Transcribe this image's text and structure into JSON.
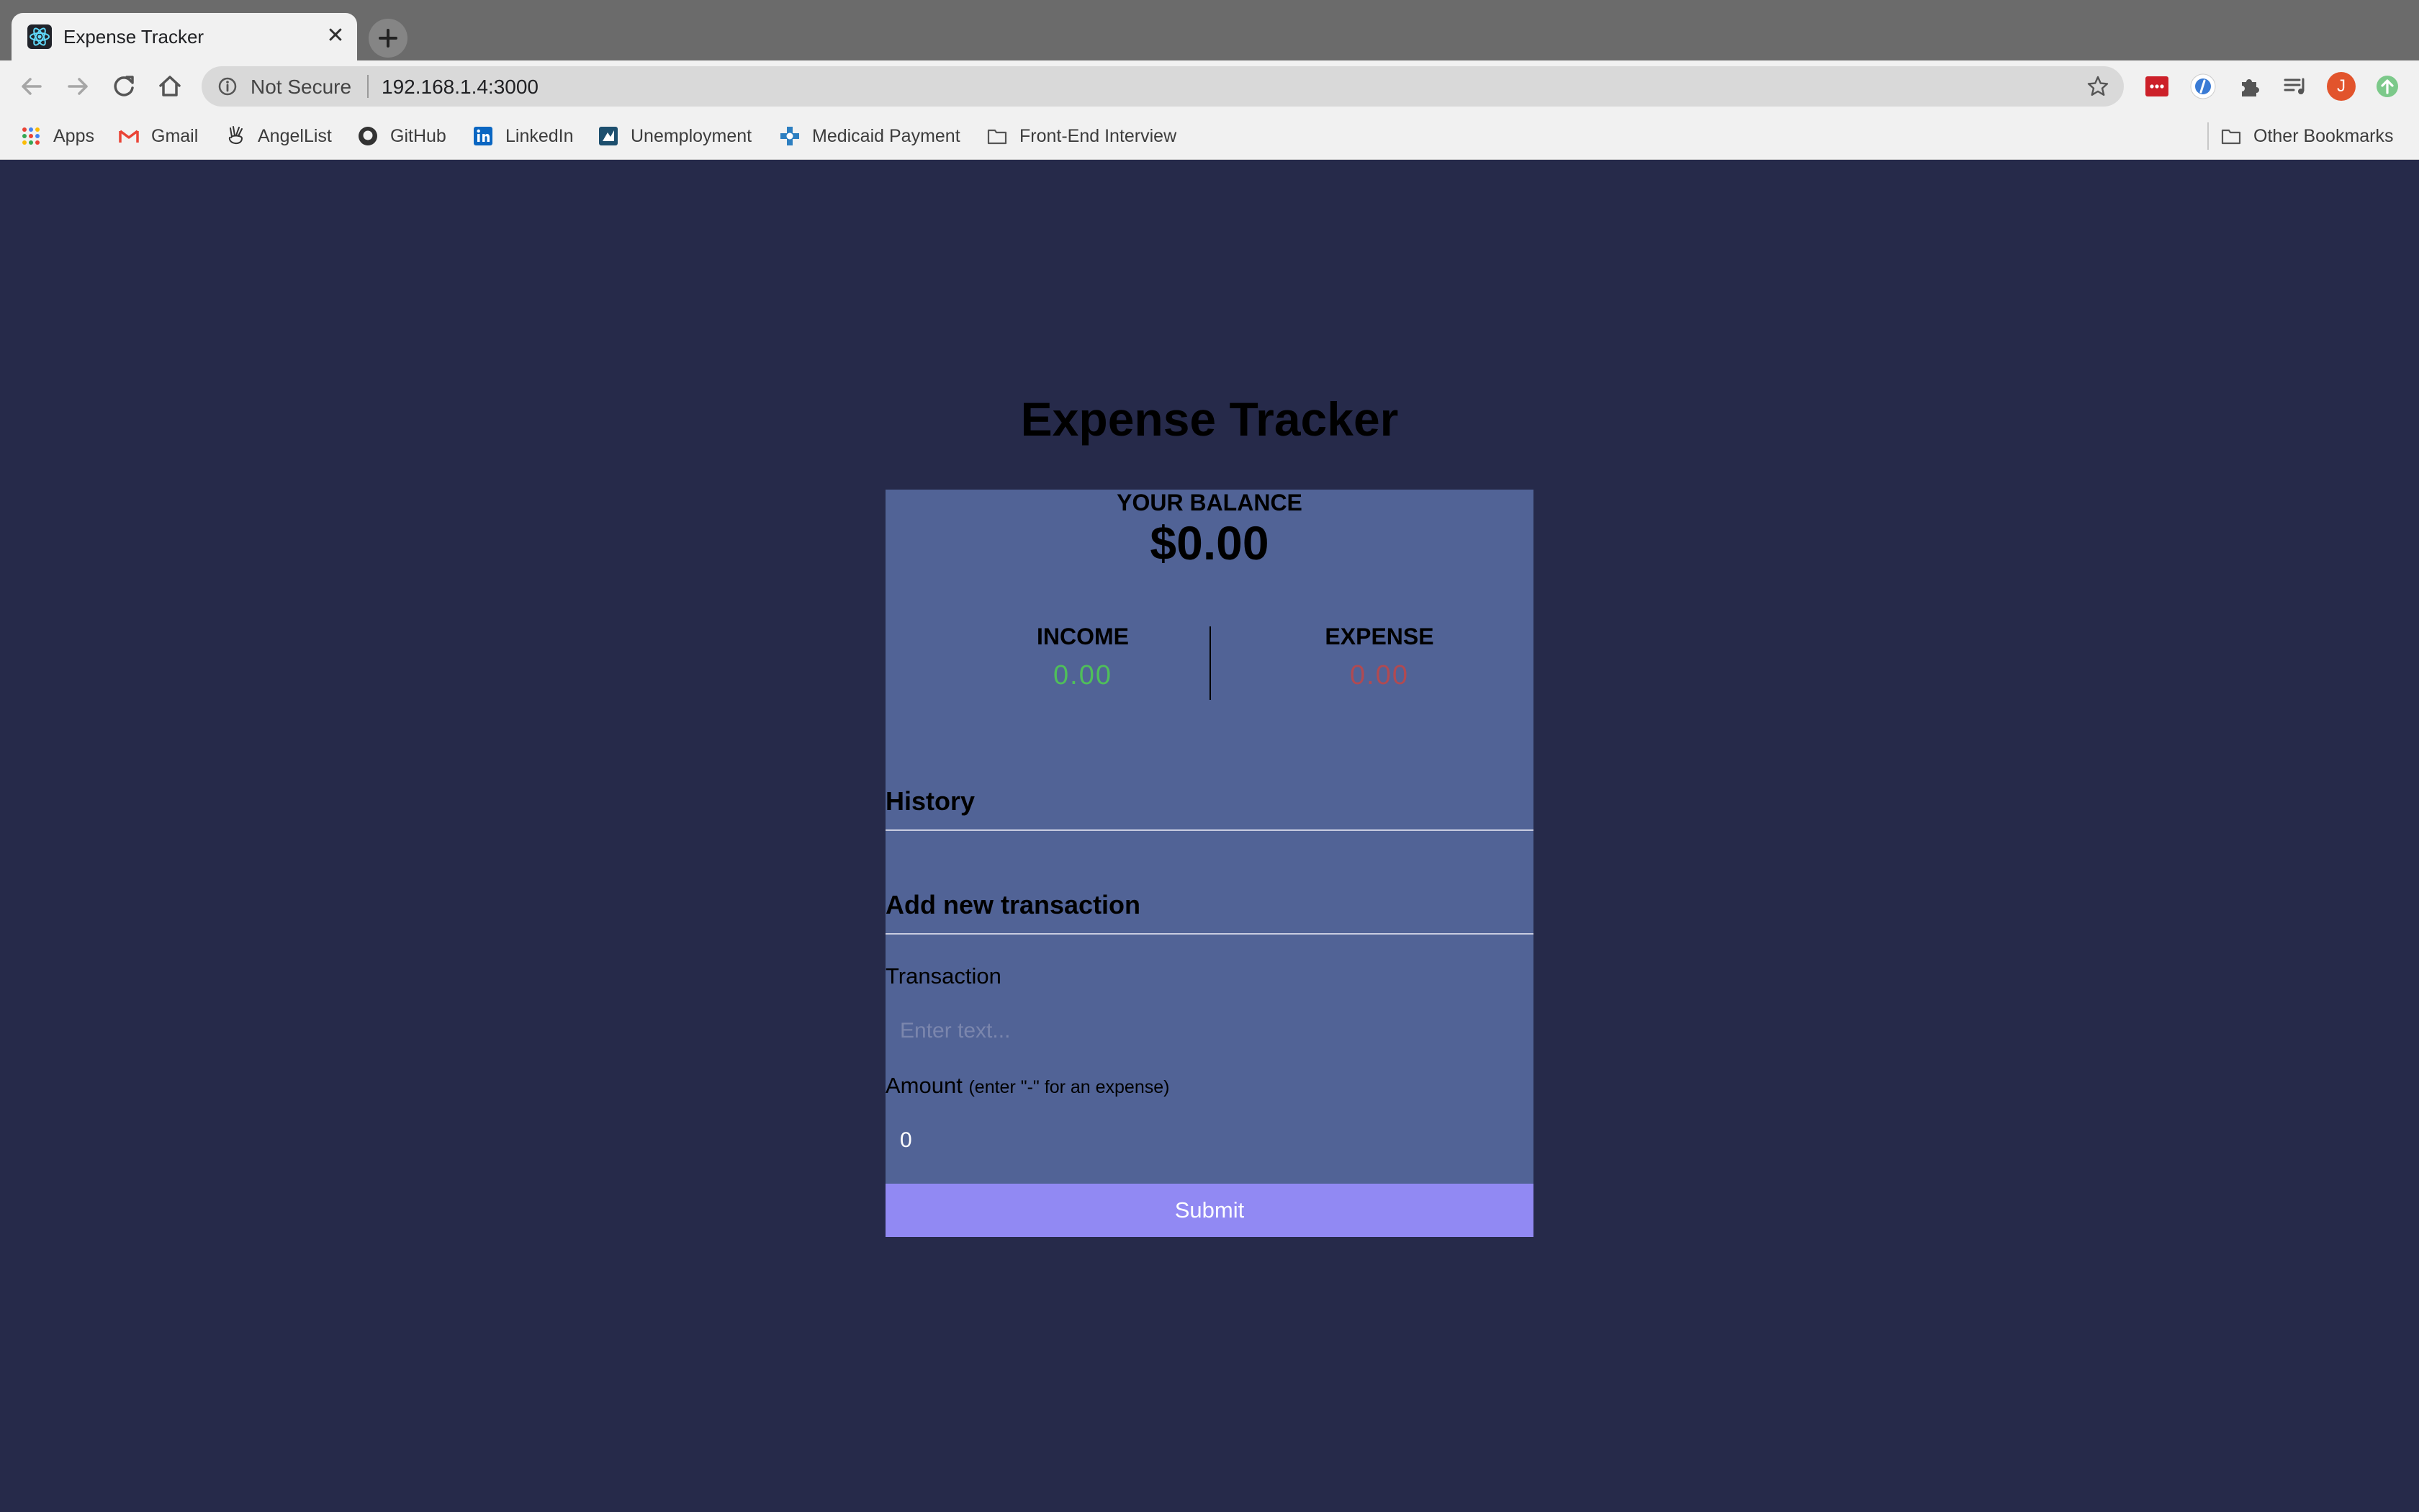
{
  "browser": {
    "tab_title": "Expense Tracker",
    "tab_close": "✕",
    "new_tab": "+",
    "not_secure": "Not Secure",
    "url": "192.168.1.4:3000",
    "bookmarks": [
      "Apps",
      "Gmail",
      "AngelList",
      "GitHub",
      "LinkedIn",
      "Unemployment",
      "Medicaid Payment",
      "Front-End Interview"
    ],
    "other_bookmarks": "Other Bookmarks",
    "profile_initial": "J"
  },
  "app": {
    "title": "Expense Tracker",
    "balance_label": "YOUR BALANCE",
    "balance_value": "$0.00",
    "income_label": "INCOME",
    "income_value": "0.00",
    "expense_label": "EXPENSE",
    "expense_value": "0.00",
    "history_heading": "History",
    "add_heading": "Add new transaction",
    "transaction_label": "Transaction",
    "transaction_placeholder": "Enter text...",
    "amount_label": "Amount",
    "amount_hint": "(enter \"-\" for an expense)",
    "amount_value": "0",
    "submit_label": "Submit"
  },
  "colors": {
    "page_bg": "#262a4a",
    "card_bg": "#516396",
    "income": "#4fbf5a",
    "expense": "#b04a52",
    "submit": "#9189f3"
  }
}
